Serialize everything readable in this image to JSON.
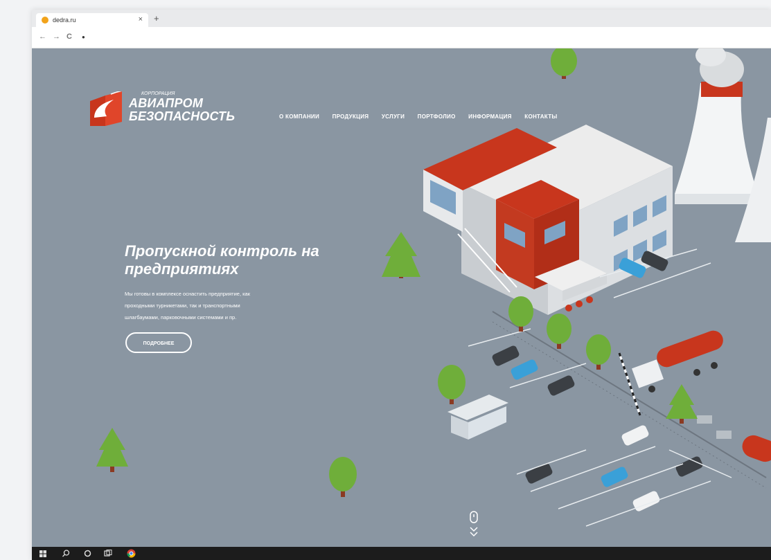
{
  "browser": {
    "tab_title": "dedra.ru",
    "close_glyph": "×",
    "new_tab_glyph": "+",
    "back_glyph": "←",
    "forward_glyph": "→",
    "reload_glyph": "C",
    "site_glyph": "●"
  },
  "site": {
    "logo_top": "КОРПОРАЦИЯ",
    "logo_line1": "АВИАПРОМ",
    "logo_line2": "БЕЗОПАСНОСТЬ",
    "nav": [
      "О КОМПАНИИ",
      "ПРОДУКЦИЯ",
      "УСЛУГИ",
      "ПОРТФОЛИО",
      "ИНФОРМАЦИЯ",
      "КОНТАКТЫ"
    ],
    "hero_title_line1": "Пропускной контроль на",
    "hero_title_line2": "предприятиях",
    "hero_text_line1": "Мы готовы в комплексе оснастить предприятие, как",
    "hero_text_line2": "проходными турникетами, так и транспортными",
    "hero_text_line3": "шлагбаумами, парковочными системами и пр.",
    "more_button": "ПОДРОБНЕЕ"
  },
  "colors": {
    "page_bg": "#8a96a2",
    "accent_red": "#c8361d",
    "text": "#ffffff",
    "taskbar": "#1c1c1c"
  },
  "taskbar": {
    "start_icon": "windows-icon",
    "search_icon": "search-icon",
    "cortana_icon": "circle-icon",
    "taskview_icon": "task-view-icon",
    "browser_icon": "chrome-icon"
  }
}
